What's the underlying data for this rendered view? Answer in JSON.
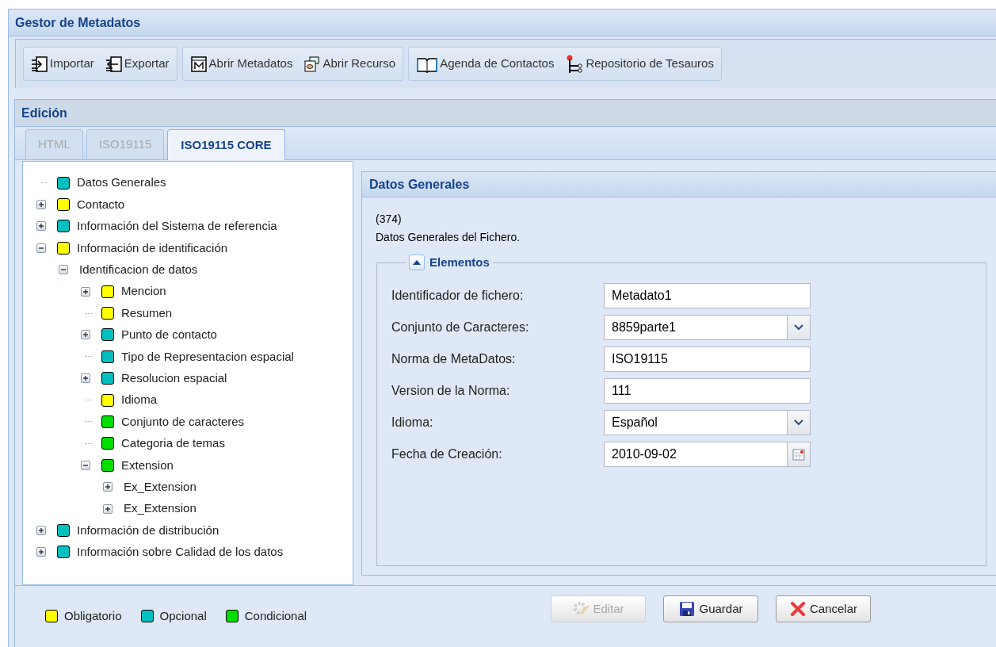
{
  "window": {
    "title": "Gestor de Metadatos"
  },
  "toolbar": {
    "groups": [
      [
        {
          "label": "Importar",
          "kind": "import"
        },
        {
          "label": "Exportar",
          "kind": "export"
        }
      ],
      [
        {
          "label": "Abrir Metadatos",
          "kind": "meta"
        },
        {
          "label": "Abrir Recurso",
          "kind": "resource"
        }
      ],
      [
        {
          "label": "Agenda de Contactos",
          "kind": "book"
        },
        {
          "label": "Repositorio de Tesauros",
          "kind": "tree"
        }
      ]
    ]
  },
  "edit_panel": {
    "title": "Edición",
    "tabs": [
      {
        "label": "HTML",
        "selected": false,
        "disabled": true
      },
      {
        "label": "ISO19115",
        "selected": false,
        "disabled": true
      },
      {
        "label": "ISO19115 CORE",
        "selected": true,
        "disabled": false
      }
    ],
    "tree": [
      {
        "label": "Datos Generales",
        "color": "#00c0c0"
      },
      {
        "label": "Contacto",
        "color": "#ffff00",
        "expanded": false
      },
      {
        "label": "Información del Sistema de referencia",
        "color": "#00c0c0",
        "expanded": false
      },
      {
        "label": "Información de identificación",
        "color": "#ffff00",
        "expanded": true,
        "children": [
          {
            "label": "Identificacion de datos",
            "expanded": true,
            "children": [
              {
                "label": "Mencion",
                "color": "#ffff00",
                "expanded": false
              },
              {
                "label": "Resumen",
                "color": "#ffff00"
              },
              {
                "label": "Punto de contacto",
                "color": "#00c0c0",
                "expanded": false
              },
              {
                "label": "Tipo de Representacion espacial",
                "color": "#00c0c0"
              },
              {
                "label": "Resolucion espacial",
                "color": "#00c0c0",
                "expanded": false
              },
              {
                "label": "Idioma",
                "color": "#ffff00"
              },
              {
                "label": "Conjunto de caracteres",
                "color": "#00e000"
              },
              {
                "label": "Categoria de temas",
                "color": "#00e000"
              },
              {
                "label": "Extension",
                "color": "#00e000",
                "expanded": true,
                "children": [
                  {
                    "label": "Ex_Extension",
                    "expanded": false
                  },
                  {
                    "label": "Ex_Extension",
                    "expanded": false
                  }
                ]
              }
            ]
          }
        ]
      },
      {
        "label": "Información de distribución",
        "color": "#00c0c0",
        "expanded": false
      },
      {
        "label": "Información sobre Calidad de los datos",
        "color": "#00c0c0",
        "expanded": false
      }
    ],
    "detail": {
      "title": "Datos Generales",
      "code": "(374)",
      "description": "Datos Generales del Fichero.",
      "fieldset": {
        "title": "Elementos",
        "expanded": true,
        "fields": [
          {
            "label": "Identificador de fichero:",
            "value": "Metadato1",
            "kind": "text"
          },
          {
            "label": "Conjunto de Caracteres:",
            "value": "8859parte1",
            "kind": "combo"
          },
          {
            "label": "Norma de MetaDatos:",
            "value": "ISO19115",
            "kind": "text"
          },
          {
            "label": "Version de la Norma:",
            "value": "111",
            "kind": "text"
          },
          {
            "label": "Idioma:",
            "value": "Español",
            "kind": "combo"
          },
          {
            "label": "Fecha de Creación:",
            "value": "2010-09-02",
            "kind": "date"
          }
        ]
      }
    },
    "legend": [
      {
        "label": "Obligatorio",
        "color": "#ffff00"
      },
      {
        "label": "Opcional",
        "color": "#00c0c0"
      },
      {
        "label": "Condicional",
        "color": "#00e000"
      }
    ],
    "buttons": [
      {
        "label": "Editar",
        "kind": "edit",
        "disabled": true
      },
      {
        "label": "Guardar",
        "kind": "save",
        "disabled": false
      },
      {
        "label": "Cancelar",
        "kind": "cancel",
        "disabled": false
      }
    ]
  }
}
